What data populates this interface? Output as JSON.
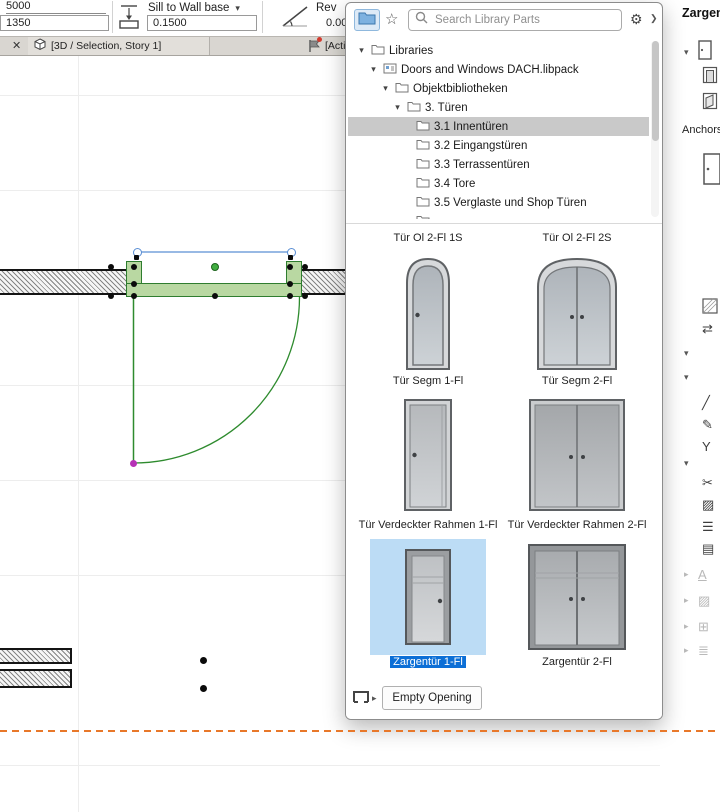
{
  "glyphs": {
    "close": "✕",
    "star": "☆",
    "gear": "⚙",
    "chevron_down": "▾",
    "chevron_right": "▸",
    "flyout": "❯"
  },
  "colors": {
    "selection_blue": "#0d6fd6",
    "selection_blue_bg": "#bcdcf5",
    "edit_green": "#2f7d2f",
    "marquee_orange": "#e8782a"
  },
  "inspector": {
    "field1_value": "5000",
    "field2_value": "1350",
    "sill_label": "Sill to Wall base",
    "sill_value": "0.1500",
    "rev_label": "Rev",
    "rev_value": "0.000"
  },
  "tabbar": {
    "tab_label": "[3D / Selection, Story 1]",
    "action_label": "[Action"
  },
  "library_popup": {
    "search_placeholder": "Search Library Parts",
    "tree": {
      "items": [
        {
          "label": "Libraries"
        },
        {
          "label": "Doors and Windows DACH.libpack"
        },
        {
          "label": "Objektbibliotheken"
        },
        {
          "label": "3. Türen"
        },
        {
          "label": "3.1 Innentüren"
        },
        {
          "label": "3.2 Eingangstüren"
        },
        {
          "label": "3.3 Terrassentüren"
        },
        {
          "label": "3.4 Tore"
        },
        {
          "label": "3.5 Verglaste und Shop Türen"
        }
      ]
    },
    "grid": {
      "partial": [
        "Tür Ol 2-Fl 1S",
        "Tür Ol 2-Fl 2S"
      ],
      "items": [
        {
          "label": "Tür Segm 1-Fl"
        },
        {
          "label": "Tür Segm 2-Fl"
        },
        {
          "label": "Tür Verdeckter Rahmen 1-Fl"
        },
        {
          "label": "Tür Verdeckter Rahmen 2-Fl"
        },
        {
          "label": "Zargentür 1-Fl",
          "selected": true
        },
        {
          "label": "Zargentür 2-Fl"
        }
      ]
    },
    "empty_opening_label": "Empty Opening"
  },
  "right_rail": {
    "title": "Zargent",
    "anchors_label": "Anchors",
    "icons": [
      {
        "name": "swap-arrows-icon",
        "glyph": "⇄"
      },
      {
        "name": "diagonal-line-icon",
        "glyph": "╱"
      },
      {
        "name": "pen-icon",
        "glyph": "✎"
      },
      {
        "name": "branch-icon",
        "glyph": "Y"
      },
      {
        "name": "scissors-icon",
        "glyph": "✂"
      },
      {
        "name": "fill-hatch-icon",
        "glyph": "▨"
      },
      {
        "name": "line-types-icon",
        "glyph": "☰"
      },
      {
        "name": "layers-icon",
        "glyph": "▤"
      },
      {
        "name": "text-style-icon",
        "glyph": "A"
      },
      {
        "name": "fill-disabled-icon",
        "glyph": "▨"
      },
      {
        "name": "grid-disabled-icon",
        "glyph": "⊞"
      },
      {
        "name": "library-disabled-icon",
        "glyph": "≣"
      }
    ]
  }
}
